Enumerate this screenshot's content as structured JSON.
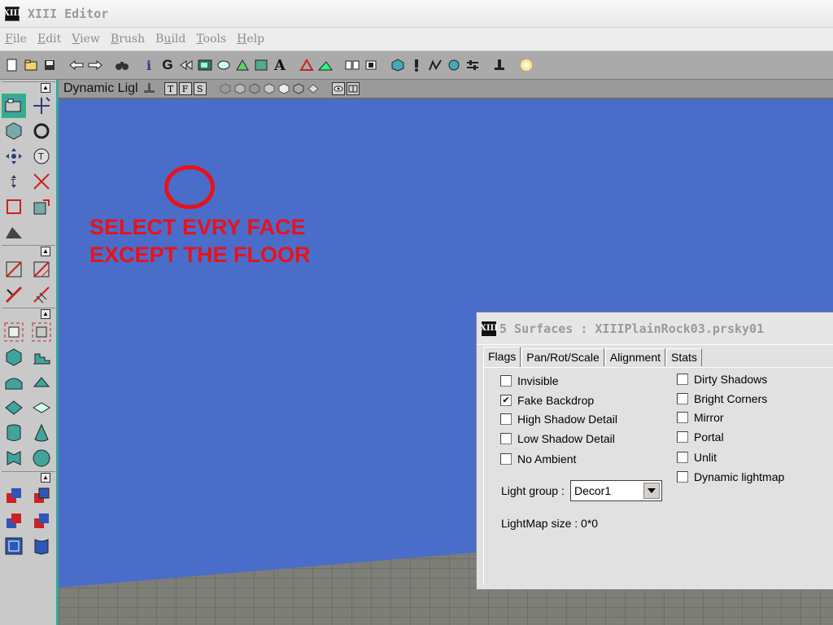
{
  "app": {
    "logo": "XIII",
    "title": "XIII Editor"
  },
  "menu": [
    {
      "pre": "",
      "ul": "F",
      "post": "ile"
    },
    {
      "pre": "",
      "ul": "E",
      "post": "dit"
    },
    {
      "pre": "",
      "ul": "V",
      "post": "iew"
    },
    {
      "pre": "",
      "ul": "B",
      "post": "rush"
    },
    {
      "pre": "B",
      "ul": "u",
      "post": "ild"
    },
    {
      "pre": "",
      "ul": "T",
      "post": "ools"
    },
    {
      "pre": "",
      "ul": "H",
      "post": "elp"
    }
  ],
  "toolbar": {
    "icons": [
      "new-icon",
      "open-icon",
      "save-icon",
      "undo-redo-icon",
      "find-icon",
      "info-icon",
      "g-icon",
      "back-icon",
      "texture-icon",
      "cam-icon",
      "mesh-icon",
      "sound-icon",
      "font-icon",
      "triangle-icon",
      "terrain-icon",
      "group-icon",
      "actor-icon",
      "cube-icon",
      "alert-icon",
      "path-icon",
      "matinee-icon",
      "slider-icon",
      "kinematic-icon",
      "light-icon"
    ],
    "g_label": "G",
    "a_label": "A",
    "i_label": "i"
  },
  "viewport": {
    "label": "Dynamic Ligl",
    "view_buttons": [
      "T",
      "F",
      "S"
    ],
    "annotation": "SELECT EVRY FACE\nEXCEPT THE FLOOR",
    "background": "#4a6dc9",
    "annotation_color": "#e8121b"
  },
  "dialog": {
    "logo": "XIII",
    "title": "5 Surfaces :  XIIIPlainRock03.prsky01",
    "tabs": [
      "Flags",
      "Pan/Rot/Scale",
      "Alignment",
      "Stats"
    ],
    "active_tab": "Flags",
    "left_flags": [
      {
        "label": "Invisible",
        "checked": false,
        "mark": ""
      },
      {
        "label": "Fake Backdrop",
        "checked": true,
        "mark": "✔"
      },
      {
        "label": "High Shadow Detail",
        "checked": false,
        "mark": ""
      },
      {
        "label": "Low Shadow Detail",
        "checked": false,
        "mark": ""
      },
      {
        "label": "No Ambient",
        "checked": false,
        "mark": ""
      }
    ],
    "right_flags": [
      {
        "label": "Dirty Shadows",
        "checked": false,
        "mark": ""
      },
      {
        "label": "Bright Corners",
        "checked": false,
        "mark": ""
      },
      {
        "label": "Mirror",
        "checked": false,
        "mark": ""
      },
      {
        "label": "Portal",
        "checked": false,
        "mark": ""
      },
      {
        "label": "Unlit",
        "checked": false,
        "mark": ""
      },
      {
        "label": "Dynamic lightmap",
        "checked": false,
        "mark": ""
      }
    ],
    "light_group_label": "Light group :",
    "light_group_value": "Decor1",
    "lightmap_size": "LightMap size : 0*0"
  },
  "sidepanel": {
    "collapse_glyph": "▲"
  }
}
